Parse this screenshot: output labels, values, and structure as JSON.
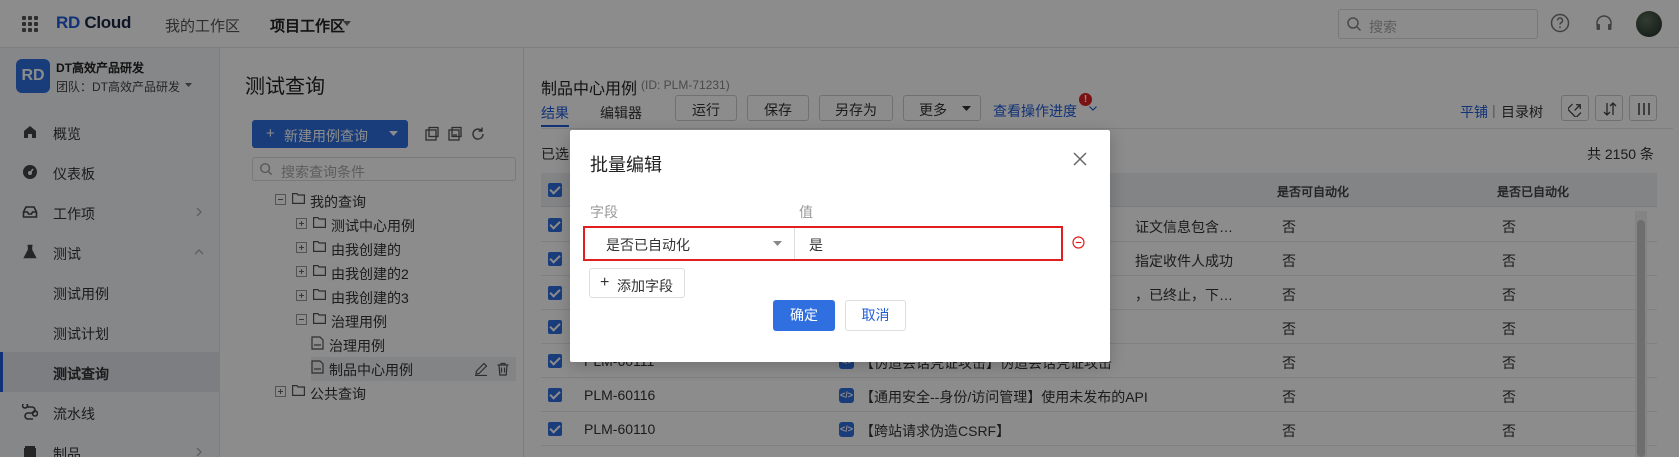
{
  "topbar": {
    "logo_rd": "RD",
    "logo_cloud": "Cloud",
    "nav_my_workspace": "我的工作区",
    "nav_project_workspace": "项目工作区",
    "search_placeholder": "搜索",
    "icons": [
      "apps-icon",
      "search-icon",
      "help-icon",
      "headset-icon",
      "avatar"
    ]
  },
  "sidebar": {
    "team_logo": "RD",
    "team_name": "DT高效产品研发",
    "team_sub": "团队：DT高效产品研发",
    "items": [
      {
        "label": "概览",
        "icon": "home-icon"
      },
      {
        "label": "仪表板",
        "icon": "dashboard-icon"
      },
      {
        "label": "工作项",
        "icon": "inbox-icon"
      },
      {
        "label": "测试",
        "icon": "flask-icon"
      },
      {
        "label": "测试用例"
      },
      {
        "label": "测试计划"
      },
      {
        "label": "测试查询"
      },
      {
        "label": "流水线",
        "icon": "pipeline-icon"
      },
      {
        "label": "制品",
        "icon": "package-icon"
      }
    ]
  },
  "query_panel": {
    "title": "测试查询",
    "new_button": "新建用例查询",
    "search_placeholder": "搜索查询条件",
    "tree": [
      {
        "label": "我的查询"
      },
      {
        "label": "测试中心用例"
      },
      {
        "label": "由我创建的"
      },
      {
        "label": "由我创建的2"
      },
      {
        "label": "由我创建的3"
      },
      {
        "label": "治理用例"
      },
      {
        "label": "治理用例"
      },
      {
        "label": "制品中心用例"
      },
      {
        "label": "公共查询"
      }
    ]
  },
  "main": {
    "title": "制品中心用例",
    "id_label": "(ID: PLM-71231)",
    "tabs": [
      "结果",
      "编辑器"
    ],
    "buttons": [
      "运行",
      "保存",
      "另存为",
      "更多"
    ],
    "progress_link": "查看操作进度",
    "progress_badge": "!",
    "view_flat": "平铺",
    "view_sep": "|",
    "view_tree": "目录树",
    "selected_text": "已选",
    "total_text": "共 2150 条",
    "columns": [
      "是否可自动化",
      "是否已自动化"
    ],
    "rows": [
      {
        "id": "",
        "name": "证文信息包含…",
        "a1": "否",
        "a2": "否"
      },
      {
        "id": "",
        "name": "指定收件人成功",
        "a1": "否",
        "a2": "否"
      },
      {
        "id": "",
        "name": "，已终止，下…",
        "a1": "否",
        "a2": "否"
      },
      {
        "id": "",
        "name": "",
        "a1": "否",
        "a2": "否"
      },
      {
        "id": "PLM-60111",
        "name": "【伪造会话凭证攻击】伪造会话凭证攻击",
        "a1": "否",
        "a2": "否"
      },
      {
        "id": "PLM-60116",
        "name": "【通用安全--身份/访问管理】使用未发布的API",
        "a1": "否",
        "a2": "否"
      },
      {
        "id": "PLM-60110",
        "name": "【跨站请求伪造CSRF】",
        "a1": "否",
        "a2": "否"
      }
    ]
  },
  "dialog": {
    "title": "批量编辑",
    "field_label": "字段",
    "value_label": "值",
    "field_value": "是否已自动化",
    "value_value": "是",
    "add_field": "添加字段",
    "ok": "确定",
    "cancel": "取消"
  },
  "colors": {
    "accent": "#2f6fe0",
    "danger": "#e02020"
  }
}
